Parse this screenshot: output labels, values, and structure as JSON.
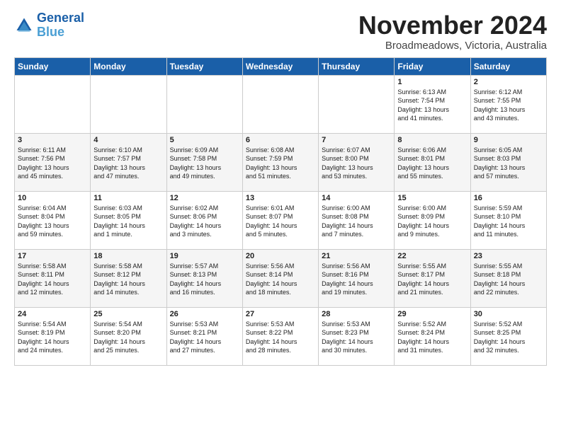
{
  "logo": {
    "line1": "General",
    "line2": "Blue"
  },
  "title": "November 2024",
  "subtitle": "Broadmeadows, Victoria, Australia",
  "days_of_week": [
    "Sunday",
    "Monday",
    "Tuesday",
    "Wednesday",
    "Thursday",
    "Friday",
    "Saturday"
  ],
  "weeks": [
    [
      {
        "day": "",
        "info": ""
      },
      {
        "day": "",
        "info": ""
      },
      {
        "day": "",
        "info": ""
      },
      {
        "day": "",
        "info": ""
      },
      {
        "day": "",
        "info": ""
      },
      {
        "day": "1",
        "info": "Sunrise: 6:13 AM\nSunset: 7:54 PM\nDaylight: 13 hours\nand 41 minutes."
      },
      {
        "day": "2",
        "info": "Sunrise: 6:12 AM\nSunset: 7:55 PM\nDaylight: 13 hours\nand 43 minutes."
      }
    ],
    [
      {
        "day": "3",
        "info": "Sunrise: 6:11 AM\nSunset: 7:56 PM\nDaylight: 13 hours\nand 45 minutes."
      },
      {
        "day": "4",
        "info": "Sunrise: 6:10 AM\nSunset: 7:57 PM\nDaylight: 13 hours\nand 47 minutes."
      },
      {
        "day": "5",
        "info": "Sunrise: 6:09 AM\nSunset: 7:58 PM\nDaylight: 13 hours\nand 49 minutes."
      },
      {
        "day": "6",
        "info": "Sunrise: 6:08 AM\nSunset: 7:59 PM\nDaylight: 13 hours\nand 51 minutes."
      },
      {
        "day": "7",
        "info": "Sunrise: 6:07 AM\nSunset: 8:00 PM\nDaylight: 13 hours\nand 53 minutes."
      },
      {
        "day": "8",
        "info": "Sunrise: 6:06 AM\nSunset: 8:01 PM\nDaylight: 13 hours\nand 55 minutes."
      },
      {
        "day": "9",
        "info": "Sunrise: 6:05 AM\nSunset: 8:03 PM\nDaylight: 13 hours\nand 57 minutes."
      }
    ],
    [
      {
        "day": "10",
        "info": "Sunrise: 6:04 AM\nSunset: 8:04 PM\nDaylight: 13 hours\nand 59 minutes."
      },
      {
        "day": "11",
        "info": "Sunrise: 6:03 AM\nSunset: 8:05 PM\nDaylight: 14 hours\nand 1 minute."
      },
      {
        "day": "12",
        "info": "Sunrise: 6:02 AM\nSunset: 8:06 PM\nDaylight: 14 hours\nand 3 minutes."
      },
      {
        "day": "13",
        "info": "Sunrise: 6:01 AM\nSunset: 8:07 PM\nDaylight: 14 hours\nand 5 minutes."
      },
      {
        "day": "14",
        "info": "Sunrise: 6:00 AM\nSunset: 8:08 PM\nDaylight: 14 hours\nand 7 minutes."
      },
      {
        "day": "15",
        "info": "Sunrise: 6:00 AM\nSunset: 8:09 PM\nDaylight: 14 hours\nand 9 minutes."
      },
      {
        "day": "16",
        "info": "Sunrise: 5:59 AM\nSunset: 8:10 PM\nDaylight: 14 hours\nand 11 minutes."
      }
    ],
    [
      {
        "day": "17",
        "info": "Sunrise: 5:58 AM\nSunset: 8:11 PM\nDaylight: 14 hours\nand 12 minutes."
      },
      {
        "day": "18",
        "info": "Sunrise: 5:58 AM\nSunset: 8:12 PM\nDaylight: 14 hours\nand 14 minutes."
      },
      {
        "day": "19",
        "info": "Sunrise: 5:57 AM\nSunset: 8:13 PM\nDaylight: 14 hours\nand 16 minutes."
      },
      {
        "day": "20",
        "info": "Sunrise: 5:56 AM\nSunset: 8:14 PM\nDaylight: 14 hours\nand 18 minutes."
      },
      {
        "day": "21",
        "info": "Sunrise: 5:56 AM\nSunset: 8:16 PM\nDaylight: 14 hours\nand 19 minutes."
      },
      {
        "day": "22",
        "info": "Sunrise: 5:55 AM\nSunset: 8:17 PM\nDaylight: 14 hours\nand 21 minutes."
      },
      {
        "day": "23",
        "info": "Sunrise: 5:55 AM\nSunset: 8:18 PM\nDaylight: 14 hours\nand 22 minutes."
      }
    ],
    [
      {
        "day": "24",
        "info": "Sunrise: 5:54 AM\nSunset: 8:19 PM\nDaylight: 14 hours\nand 24 minutes."
      },
      {
        "day": "25",
        "info": "Sunrise: 5:54 AM\nSunset: 8:20 PM\nDaylight: 14 hours\nand 25 minutes."
      },
      {
        "day": "26",
        "info": "Sunrise: 5:53 AM\nSunset: 8:21 PM\nDaylight: 14 hours\nand 27 minutes."
      },
      {
        "day": "27",
        "info": "Sunrise: 5:53 AM\nSunset: 8:22 PM\nDaylight: 14 hours\nand 28 minutes."
      },
      {
        "day": "28",
        "info": "Sunrise: 5:53 AM\nSunset: 8:23 PM\nDaylight: 14 hours\nand 30 minutes."
      },
      {
        "day": "29",
        "info": "Sunrise: 5:52 AM\nSunset: 8:24 PM\nDaylight: 14 hours\nand 31 minutes."
      },
      {
        "day": "30",
        "info": "Sunrise: 5:52 AM\nSunset: 8:25 PM\nDaylight: 14 hours\nand 32 minutes."
      }
    ]
  ]
}
